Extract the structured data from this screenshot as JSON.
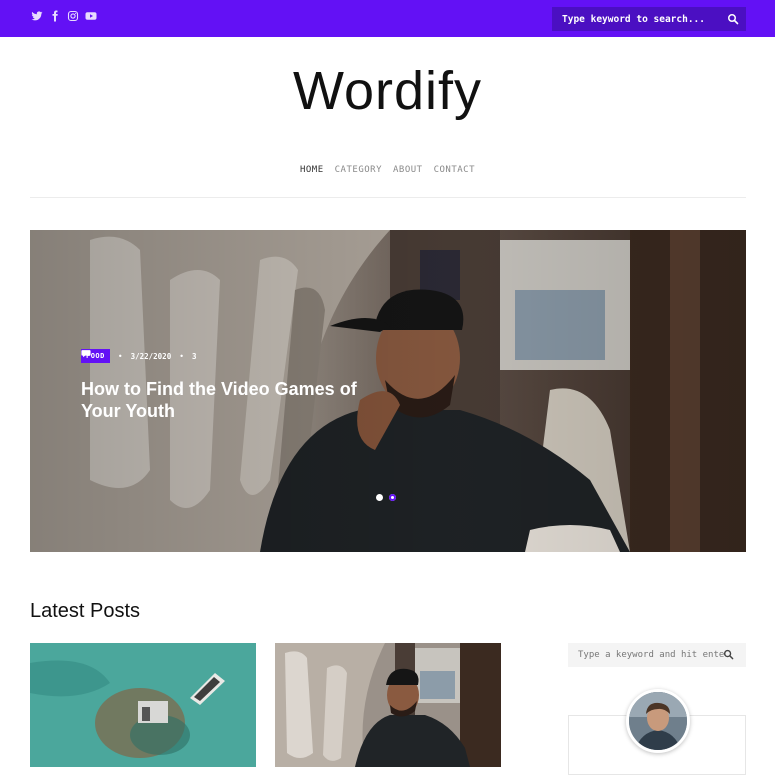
{
  "colors": {
    "accent": "#6311f5",
    "accent_dark": "#4b0fc2"
  },
  "header": {
    "social_icons": [
      "twitter-icon",
      "facebook-icon",
      "instagram-icon",
      "youtube-icon"
    ],
    "search_placeholder": "Type keyword to search..."
  },
  "site": {
    "logo": "Wordify"
  },
  "nav": {
    "home": "HOME",
    "category": "CATEGORY",
    "about": "ABOUT",
    "contact": "CONTACT"
  },
  "hero": {
    "category": "FOOD",
    "date": "3/22/2020",
    "comments": "3",
    "title": "How to Find the Video Games of Your Youth",
    "slides_total": 2
  },
  "latest": {
    "heading": "Latest Posts"
  },
  "sidebar": {
    "search_placeholder": "Type a keyword and hit enter"
  }
}
